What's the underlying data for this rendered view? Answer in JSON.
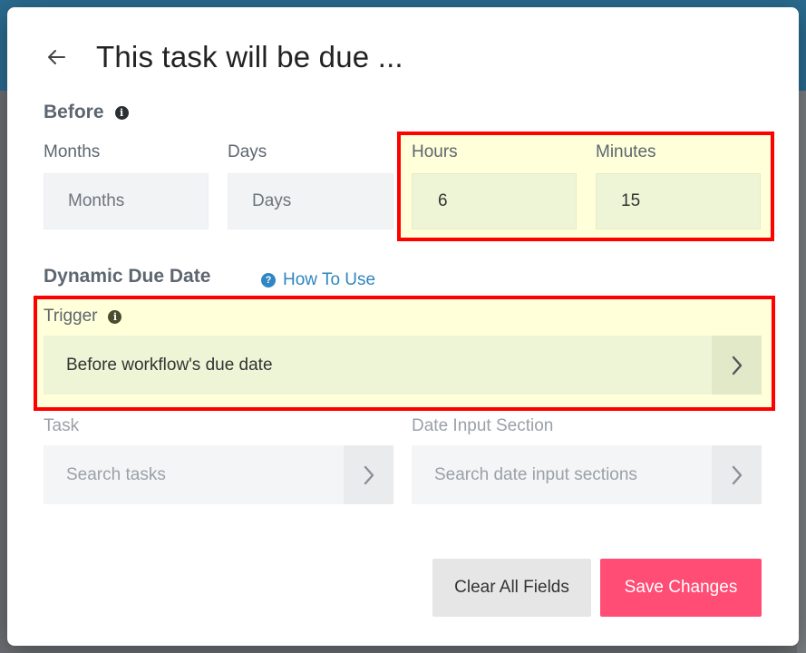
{
  "header": {
    "title": "This task will be due ..."
  },
  "before": {
    "title": "Before",
    "months": {
      "label": "Months",
      "placeholder": "Months"
    },
    "days": {
      "label": "Days",
      "placeholder": "Days"
    },
    "hours": {
      "label": "Hours",
      "value": "6"
    },
    "minutes": {
      "label": "Minutes",
      "value": "15"
    }
  },
  "dynamic": {
    "title": "Dynamic Due Date",
    "how_to_use": "How To Use",
    "trigger": {
      "label": "Trigger",
      "value": "Before workflow's due date"
    },
    "task": {
      "label": "Task",
      "placeholder": "Search tasks"
    },
    "date_input": {
      "label": "Date Input Section",
      "placeholder": "Search date input sections"
    }
  },
  "footer": {
    "clear_label": "Clear All Fields",
    "save_label": "Save Changes"
  },
  "colors": {
    "accent_save": "#ff4d75",
    "link": "#2f86c2",
    "highlight": "#ffffd9",
    "annotation": "#ff0000"
  }
}
